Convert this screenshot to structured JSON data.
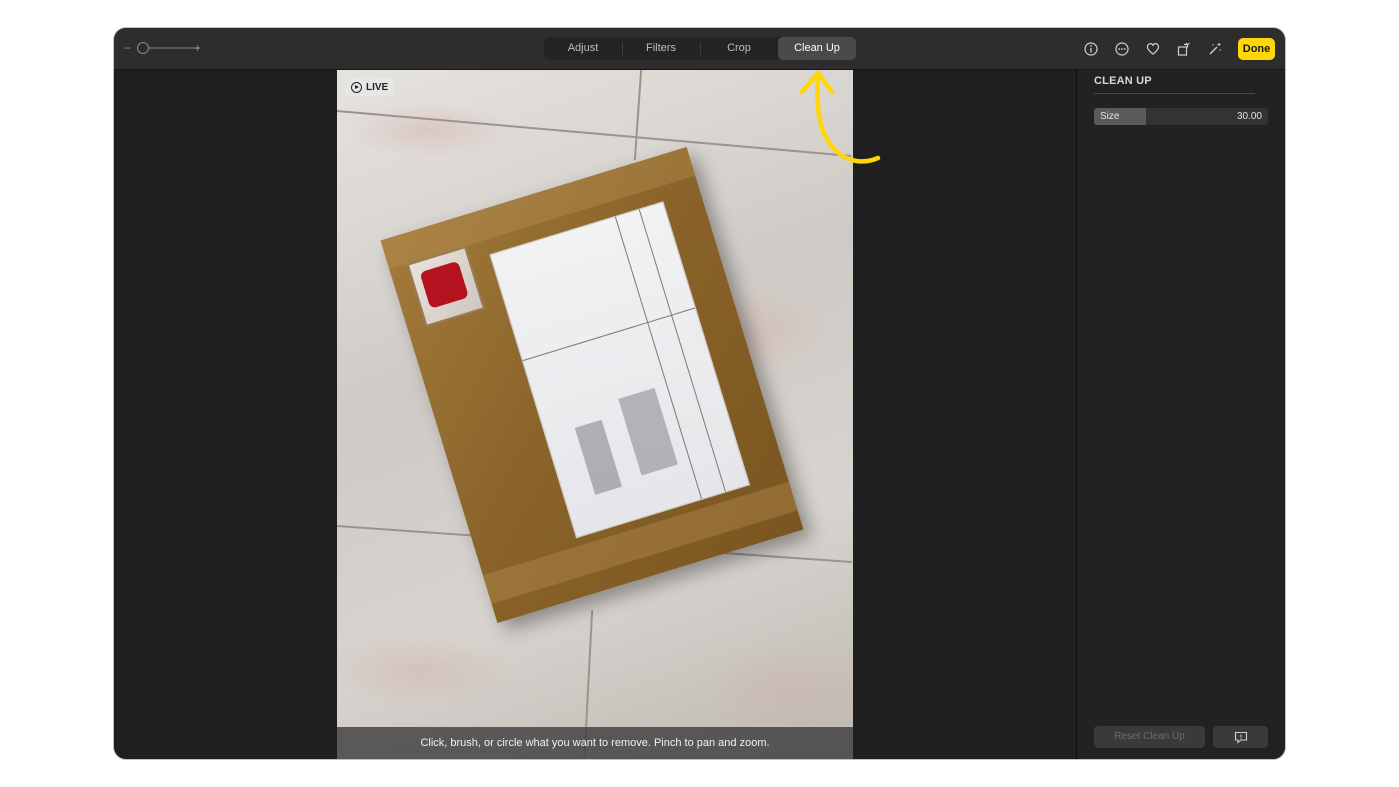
{
  "toolbar": {
    "zoom": {
      "minus": "−",
      "plus": "+"
    },
    "tabs": [
      {
        "label": "Adjust"
      },
      {
        "label": "Filters"
      },
      {
        "label": "Crop"
      },
      {
        "label": "Clean Up"
      }
    ],
    "active_tab": "Clean Up",
    "icons": [
      "info-icon",
      "more-icon",
      "heart-icon",
      "rotate-icon",
      "magic-wand-icon"
    ],
    "done_label": "Done",
    "accent_color": "#ffd60a"
  },
  "photo": {
    "live_badge": "LIVE",
    "hint": "Click, brush, or circle what you want to remove. Pinch to pan and zoom."
  },
  "panel": {
    "title": "CLEAN UP",
    "size": {
      "label": "Size",
      "value": "30.00",
      "fill_fraction": 0.3
    },
    "reset_label": "Reset Clean Up"
  },
  "annotation": {
    "arrow_color": "#ffd60a"
  }
}
